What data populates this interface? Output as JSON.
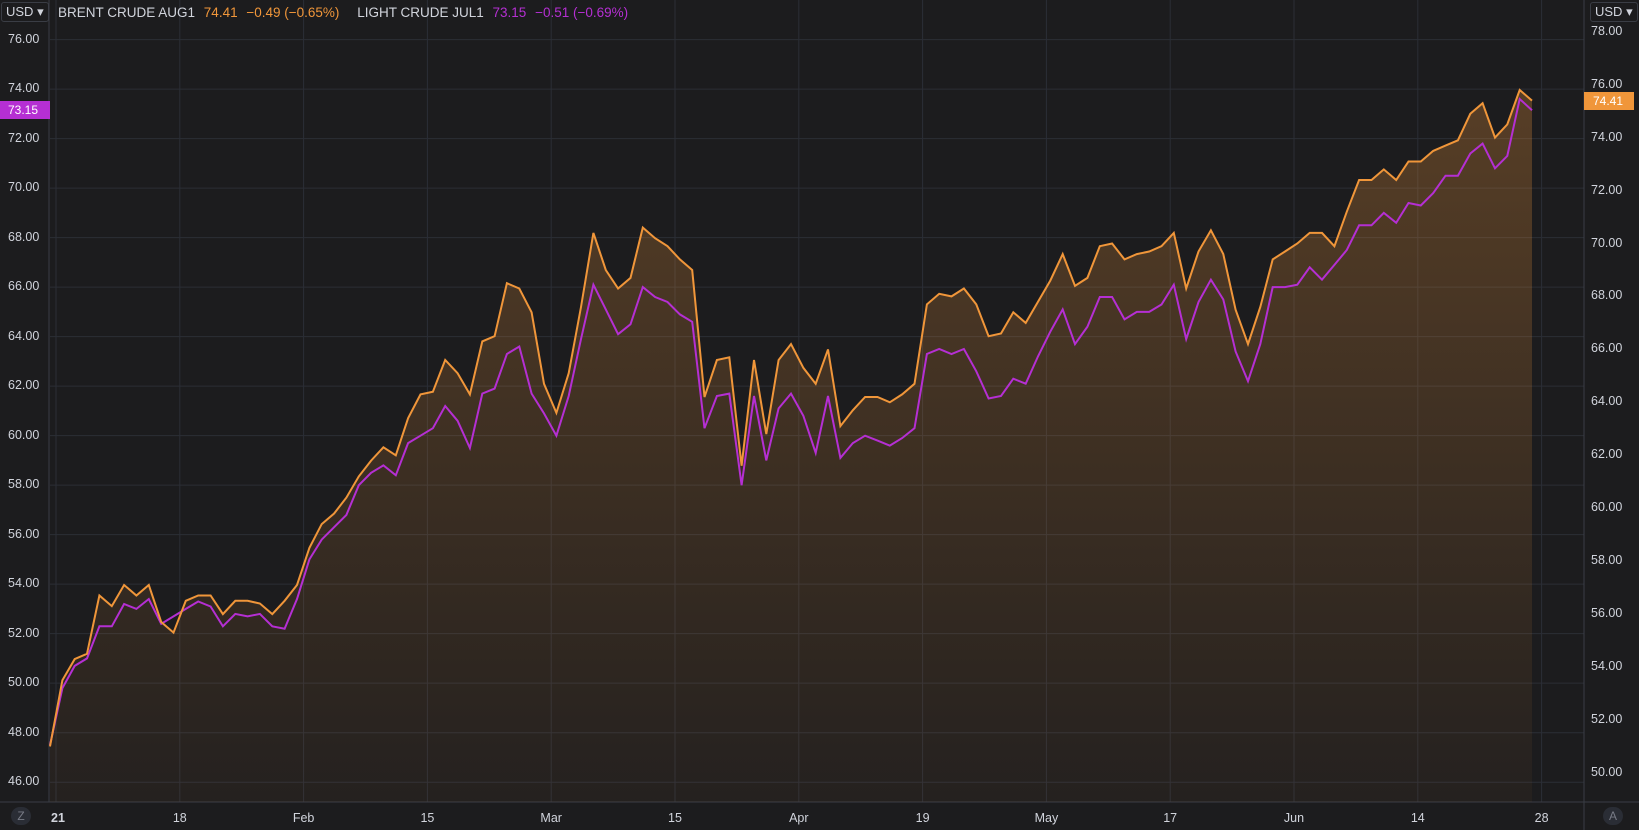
{
  "currency_left": "USD",
  "currency_right": "USD",
  "corner_left": "Z",
  "corner_right": "A",
  "series_meta": [
    {
      "name": "BRENT CRUDE AUG1",
      "value": "74.41",
      "change": "−0.49 (−0.65%)",
      "color": "#f0963a"
    },
    {
      "name": "LIGHT CRUDE JUL1",
      "value": "73.15",
      "change": "−0.51 (−0.69%)",
      "color": "#b52fd3"
    }
  ],
  "chart_data": {
    "type": "line",
    "x_ticks": [
      "21",
      "18",
      "Feb",
      "15",
      "Mar",
      "15",
      "Apr",
      "19",
      "May",
      "17",
      "Jun",
      "14",
      "28"
    ],
    "left_axis": {
      "ticks": [
        "46.00",
        "48.00",
        "50.00",
        "52.00",
        "54.00",
        "56.00",
        "58.00",
        "60.00",
        "62.00",
        "64.00",
        "66.00",
        "68.00",
        "70.00",
        "72.00",
        "74.00",
        "76.00"
      ],
      "ylim": [
        45.2,
        77.6
      ]
    },
    "right_axis": {
      "ticks": [
        "50.00",
        "52.00",
        "54.00",
        "56.00",
        "58.00",
        "60.00",
        "62.00",
        "64.00",
        "66.00",
        "68.00",
        "70.00",
        "72.00",
        "74.00",
        "76.00",
        "78.00"
      ],
      "ylim": [
        48.9,
        79.2
      ]
    },
    "series": [
      {
        "name": "BRENT CRUDE AUG1",
        "axis": "right",
        "color": "#f0963a",
        "last": "74.41",
        "values": [
          51.0,
          53.5,
          54.3,
          54.5,
          56.7,
          56.3,
          57.1,
          56.7,
          57.1,
          55.7,
          55.3,
          56.5,
          56.7,
          56.7,
          56.0,
          56.5,
          56.5,
          56.4,
          56.0,
          56.5,
          57.1,
          58.5,
          59.4,
          59.8,
          60.4,
          61.2,
          61.8,
          62.3,
          62.0,
          63.4,
          64.3,
          64.4,
          65.6,
          65.1,
          64.3,
          66.3,
          66.5,
          68.5,
          68.3,
          67.4,
          64.7,
          63.6,
          65.1,
          67.6,
          70.4,
          69.0,
          68.3,
          68.7,
          70.6,
          70.2,
          69.9,
          69.4,
          69.0,
          64.2,
          65.6,
          65.7,
          61.6,
          65.6,
          62.8,
          65.6,
          66.2,
          65.3,
          64.7,
          66.0,
          63.1,
          63.7,
          64.2,
          64.2,
          64.0,
          64.3,
          64.7,
          67.7,
          68.1,
          68.0,
          68.3,
          67.7,
          66.5,
          66.6,
          67.4,
          67.0,
          67.8,
          68.6,
          69.6,
          68.4,
          68.7,
          69.9,
          70.0,
          69.4,
          69.6,
          69.7,
          69.9,
          70.4,
          68.3,
          69.7,
          70.5,
          69.6,
          67.5,
          66.2,
          67.6,
          69.4,
          69.7,
          70.0,
          70.4,
          70.4,
          69.9,
          71.2,
          72.4,
          72.4,
          72.8,
          72.4,
          73.1,
          73.1,
          73.5,
          73.7,
          73.9,
          74.9,
          75.3,
          74.0,
          74.5,
          75.8,
          75.4
        ],
        "note": "values read against the right axis"
      },
      {
        "name": "LIGHT CRUDE JUL1",
        "axis": "left",
        "color": "#b52fd3",
        "last": "73.15",
        "values": [
          47.5,
          49.8,
          50.7,
          51.0,
          52.3,
          52.3,
          53.2,
          53.0,
          53.4,
          52.4,
          52.7,
          53.0,
          53.3,
          53.1,
          52.3,
          52.8,
          52.7,
          52.8,
          52.3,
          52.2,
          53.4,
          55.0,
          55.8,
          56.3,
          56.8,
          58.0,
          58.5,
          58.8,
          58.4,
          59.7,
          60.0,
          60.3,
          61.2,
          60.6,
          59.5,
          61.7,
          61.9,
          63.3,
          63.6,
          61.7,
          60.9,
          60.0,
          61.6,
          63.9,
          66.1,
          65.1,
          64.1,
          64.5,
          66.0,
          65.6,
          65.4,
          64.9,
          64.6,
          60.3,
          61.6,
          61.7,
          58.0,
          61.6,
          59.0,
          61.1,
          61.7,
          60.8,
          59.3,
          61.6,
          59.1,
          59.7,
          60.0,
          59.8,
          59.6,
          59.9,
          60.3,
          63.3,
          63.5,
          63.3,
          63.5,
          62.6,
          61.5,
          61.6,
          62.3,
          62.1,
          63.2,
          64.2,
          65.1,
          63.7,
          64.4,
          65.6,
          65.6,
          64.7,
          65.0,
          65.0,
          65.3,
          66.1,
          63.9,
          65.4,
          66.3,
          65.5,
          63.4,
          62.2,
          63.7,
          66.0,
          66.0,
          66.1,
          66.8,
          66.3,
          66.9,
          67.5,
          68.5,
          68.5,
          69.0,
          68.6,
          69.4,
          69.3,
          69.8,
          70.5,
          70.5,
          71.4,
          71.8,
          70.8,
          71.3,
          73.6,
          73.15
        ]
      }
    ]
  }
}
